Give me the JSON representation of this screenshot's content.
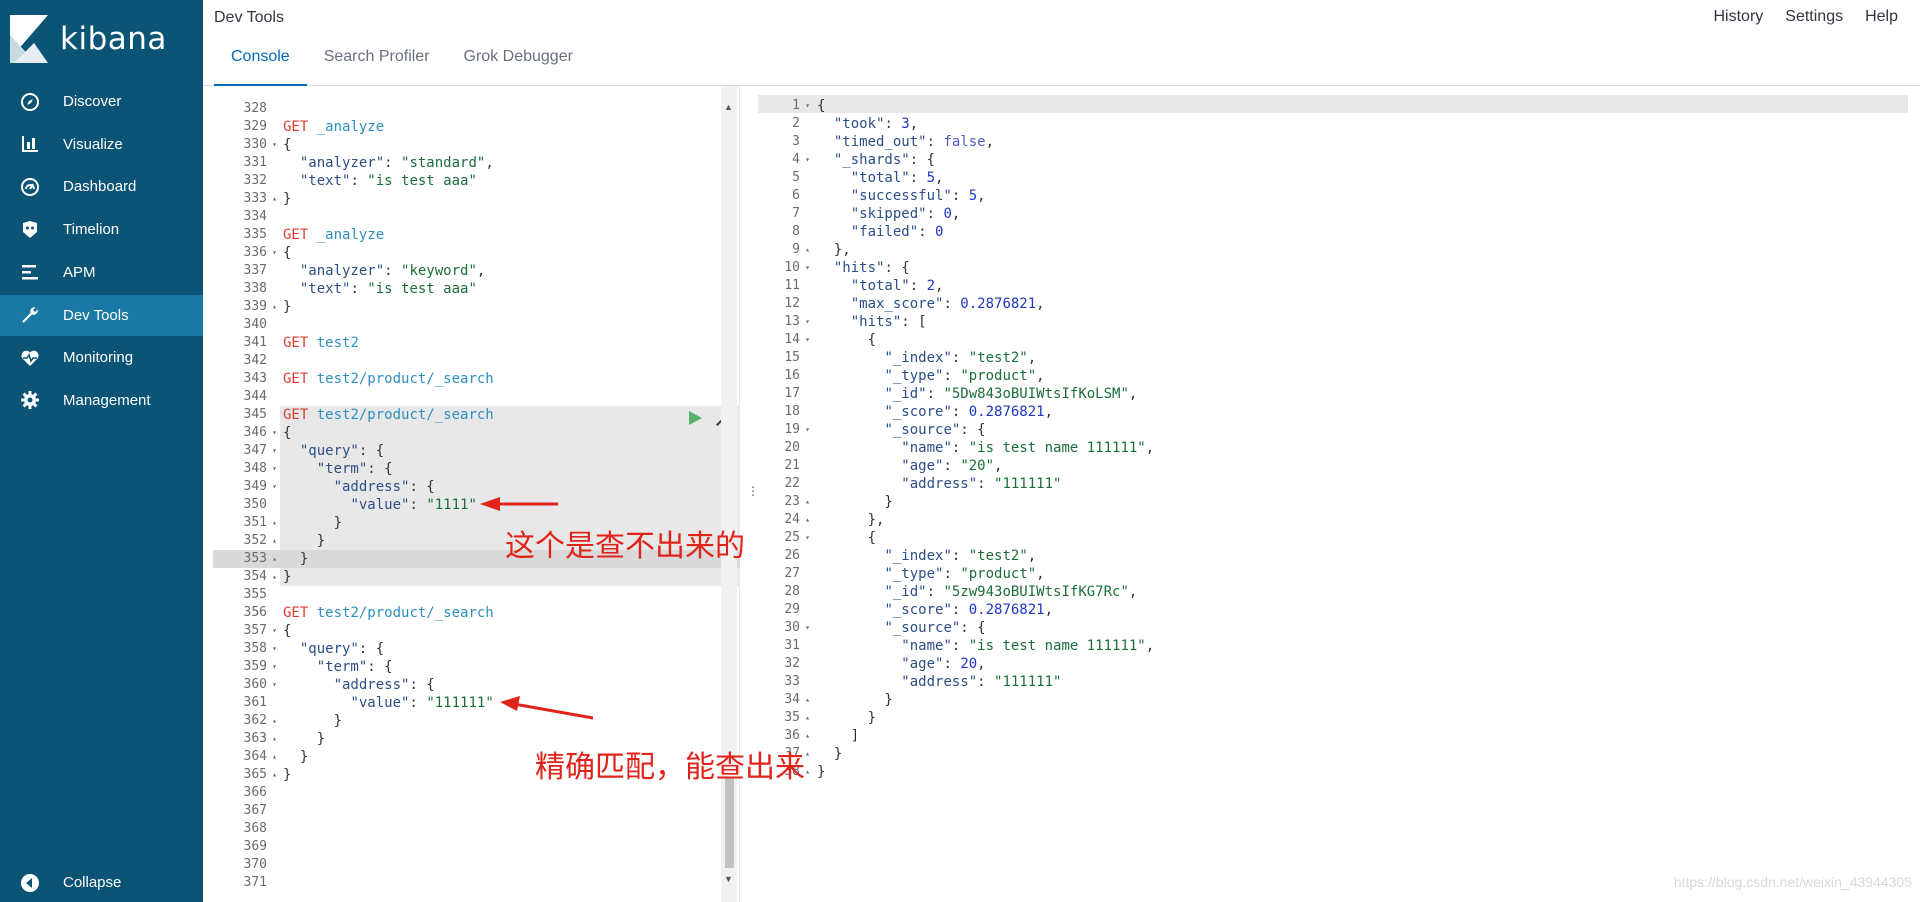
{
  "app": {
    "name": "kibana",
    "title": "Dev Tools"
  },
  "sidebar": {
    "items": [
      {
        "label": "Discover",
        "icon": "compass-icon"
      },
      {
        "label": "Visualize",
        "icon": "bar-chart-icon"
      },
      {
        "label": "Dashboard",
        "icon": "dashboard-icon"
      },
      {
        "label": "Timelion",
        "icon": "timelion-icon"
      },
      {
        "label": "APM",
        "icon": "apm-icon"
      },
      {
        "label": "Dev Tools",
        "icon": "wrench-icon",
        "active": true
      },
      {
        "label": "Monitoring",
        "icon": "heartbeat-icon"
      },
      {
        "label": "Management",
        "icon": "gear-icon"
      }
    ],
    "collapse": "Collapse"
  },
  "topnav": {
    "history": "History",
    "settings": "Settings",
    "help": "Help"
  },
  "tabs": [
    {
      "label": "Console",
      "active": true
    },
    {
      "label": "Search Profiler"
    },
    {
      "label": "Grok Debugger"
    }
  ],
  "colors": {
    "sidebar": "#0c5475",
    "sidebar_active": "#1a78a5",
    "accent": "#006bb4",
    "method": "#dd3b2e",
    "annotation": "#e0241a"
  },
  "request_lines": [
    {
      "n": "328",
      "f": "",
      "t": []
    },
    {
      "n": "329",
      "f": "",
      "t": [
        [
          "method",
          "GET"
        ],
        [
          "punc",
          " "
        ],
        [
          "path",
          "_analyze"
        ]
      ]
    },
    {
      "n": "330",
      "f": "▾",
      "t": [
        [
          "punc",
          "{"
        ]
      ]
    },
    {
      "n": "331",
      "f": "",
      "t": [
        [
          "punc",
          "  "
        ],
        [
          "key",
          "\"analyzer\""
        ],
        [
          "punc",
          ": "
        ],
        [
          "str",
          "\"standard\""
        ],
        [
          "punc",
          ","
        ]
      ]
    },
    {
      "n": "332",
      "f": "",
      "t": [
        [
          "punc",
          "  "
        ],
        [
          "key",
          "\"text\""
        ],
        [
          "punc",
          ": "
        ],
        [
          "str",
          "\"is test aaa\""
        ]
      ]
    },
    {
      "n": "333",
      "f": "▴",
      "t": [
        [
          "punc",
          "}"
        ]
      ]
    },
    {
      "n": "334",
      "f": "",
      "t": []
    },
    {
      "n": "335",
      "f": "",
      "t": [
        [
          "method",
          "GET"
        ],
        [
          "punc",
          " "
        ],
        [
          "path",
          "_analyze"
        ]
      ]
    },
    {
      "n": "336",
      "f": "▾",
      "t": [
        [
          "punc",
          "{"
        ]
      ]
    },
    {
      "n": "337",
      "f": "",
      "t": [
        [
          "punc",
          "  "
        ],
        [
          "key",
          "\"analyzer\""
        ],
        [
          "punc",
          ": "
        ],
        [
          "str",
          "\"keyword\""
        ],
        [
          "punc",
          ","
        ]
      ]
    },
    {
      "n": "338",
      "f": "",
      "t": [
        [
          "punc",
          "  "
        ],
        [
          "key",
          "\"text\""
        ],
        [
          "punc",
          ": "
        ],
        [
          "str",
          "\"is test aaa\""
        ]
      ]
    },
    {
      "n": "339",
      "f": "▴",
      "t": [
        [
          "punc",
          "}"
        ]
      ]
    },
    {
      "n": "340",
      "f": "",
      "t": []
    },
    {
      "n": "341",
      "f": "",
      "t": [
        [
          "method",
          "GET"
        ],
        [
          "punc",
          " "
        ],
        [
          "path",
          "test2"
        ]
      ]
    },
    {
      "n": "342",
      "f": "",
      "t": []
    },
    {
      "n": "343",
      "f": "",
      "t": [
        [
          "method",
          "GET"
        ],
        [
          "punc",
          " "
        ],
        [
          "path",
          "test2/product/_search"
        ]
      ]
    },
    {
      "n": "344",
      "f": "",
      "t": []
    },
    {
      "n": "345",
      "f": "",
      "t": [
        [
          "method",
          "GET"
        ],
        [
          "punc",
          " "
        ],
        [
          "path",
          "test2/product/_search"
        ]
      ]
    },
    {
      "n": "346",
      "f": "▾",
      "t": [
        [
          "punc",
          "{"
        ]
      ]
    },
    {
      "n": "347",
      "f": "▾",
      "t": [
        [
          "punc",
          "  "
        ],
        [
          "key",
          "\"query\""
        ],
        [
          "punc",
          ": {"
        ]
      ]
    },
    {
      "n": "348",
      "f": "▾",
      "t": [
        [
          "punc",
          "    "
        ],
        [
          "key",
          "\"term\""
        ],
        [
          "punc",
          ": {"
        ]
      ]
    },
    {
      "n": "349",
      "f": "▾",
      "t": [
        [
          "punc",
          "      "
        ],
        [
          "key",
          "\"address\""
        ],
        [
          "punc",
          ": {"
        ]
      ]
    },
    {
      "n": "350",
      "f": "",
      "t": [
        [
          "punc",
          "        "
        ],
        [
          "key",
          "\"value\""
        ],
        [
          "punc",
          ": "
        ],
        [
          "str",
          "\"1111\""
        ]
      ]
    },
    {
      "n": "351",
      "f": "▴",
      "t": [
        [
          "punc",
          "      }"
        ]
      ]
    },
    {
      "n": "352",
      "f": "▴",
      "t": [
        [
          "punc",
          "    }"
        ]
      ]
    },
    {
      "n": "353",
      "f": "▴",
      "t": [
        [
          "punc",
          "  }"
        ]
      ]
    },
    {
      "n": "354",
      "f": "▴",
      "t": [
        [
          "punc",
          "}"
        ]
      ]
    },
    {
      "n": "355",
      "f": "",
      "t": []
    },
    {
      "n": "356",
      "f": "",
      "t": [
        [
          "method",
          "GET"
        ],
        [
          "punc",
          " "
        ],
        [
          "path",
          "test2/product/_search"
        ]
      ]
    },
    {
      "n": "357",
      "f": "▾",
      "t": [
        [
          "punc",
          "{"
        ]
      ]
    },
    {
      "n": "358",
      "f": "▾",
      "t": [
        [
          "punc",
          "  "
        ],
        [
          "key",
          "\"query\""
        ],
        [
          "punc",
          ": {"
        ]
      ]
    },
    {
      "n": "359",
      "f": "▾",
      "t": [
        [
          "punc",
          "    "
        ],
        [
          "key",
          "\"term\""
        ],
        [
          "punc",
          ": {"
        ]
      ]
    },
    {
      "n": "360",
      "f": "▾",
      "t": [
        [
          "punc",
          "      "
        ],
        [
          "key",
          "\"address\""
        ],
        [
          "punc",
          ": {"
        ]
      ]
    },
    {
      "n": "361",
      "f": "",
      "t": [
        [
          "punc",
          "        "
        ],
        [
          "key",
          "\"value\""
        ],
        [
          "punc",
          ": "
        ],
        [
          "str",
          "\"111111\""
        ]
      ]
    },
    {
      "n": "362",
      "f": "▴",
      "t": [
        [
          "punc",
          "      }"
        ]
      ]
    },
    {
      "n": "363",
      "f": "▴",
      "t": [
        [
          "punc",
          "    }"
        ]
      ]
    },
    {
      "n": "364",
      "f": "▴",
      "t": [
        [
          "punc",
          "  }"
        ]
      ]
    },
    {
      "n": "365",
      "f": "▴",
      "t": [
        [
          "punc",
          "}"
        ]
      ]
    },
    {
      "n": "366",
      "f": "",
      "t": []
    },
    {
      "n": "367",
      "f": "",
      "t": []
    },
    {
      "n": "368",
      "f": "",
      "t": []
    },
    {
      "n": "369",
      "f": "",
      "t": []
    },
    {
      "n": "370",
      "f": "",
      "t": []
    },
    {
      "n": "371",
      "f": "",
      "t": []
    }
  ],
  "response_lines": [
    {
      "n": "1",
      "f": "▾",
      "t": [
        [
          "punc",
          "{"
        ]
      ]
    },
    {
      "n": "2",
      "f": "",
      "t": [
        [
          "punc",
          "  "
        ],
        [
          "key",
          "\"took\""
        ],
        [
          "punc",
          ": "
        ],
        [
          "num",
          "3"
        ],
        [
          "punc",
          ","
        ]
      ]
    },
    {
      "n": "3",
      "f": "",
      "t": [
        [
          "punc",
          "  "
        ],
        [
          "key",
          "\"timed_out\""
        ],
        [
          "punc",
          ": "
        ],
        [
          "bool",
          "false"
        ],
        [
          "punc",
          ","
        ]
      ]
    },
    {
      "n": "4",
      "f": "▾",
      "t": [
        [
          "punc",
          "  "
        ],
        [
          "key",
          "\"_shards\""
        ],
        [
          "punc",
          ": {"
        ]
      ]
    },
    {
      "n": "5",
      "f": "",
      "t": [
        [
          "punc",
          "    "
        ],
        [
          "key",
          "\"total\""
        ],
        [
          "punc",
          ": "
        ],
        [
          "num",
          "5"
        ],
        [
          "punc",
          ","
        ]
      ]
    },
    {
      "n": "6",
      "f": "",
      "t": [
        [
          "punc",
          "    "
        ],
        [
          "key",
          "\"successful\""
        ],
        [
          "punc",
          ": "
        ],
        [
          "num",
          "5"
        ],
        [
          "punc",
          ","
        ]
      ]
    },
    {
      "n": "7",
      "f": "",
      "t": [
        [
          "punc",
          "    "
        ],
        [
          "key",
          "\"skipped\""
        ],
        [
          "punc",
          ": "
        ],
        [
          "num",
          "0"
        ],
        [
          "punc",
          ","
        ]
      ]
    },
    {
      "n": "8",
      "f": "",
      "t": [
        [
          "punc",
          "    "
        ],
        [
          "key",
          "\"failed\""
        ],
        [
          "punc",
          ": "
        ],
        [
          "num",
          "0"
        ]
      ]
    },
    {
      "n": "9",
      "f": "▴",
      "t": [
        [
          "punc",
          "  },"
        ]
      ]
    },
    {
      "n": "10",
      "f": "▾",
      "t": [
        [
          "punc",
          "  "
        ],
        [
          "key",
          "\"hits\""
        ],
        [
          "punc",
          ": {"
        ]
      ]
    },
    {
      "n": "11",
      "f": "",
      "t": [
        [
          "punc",
          "    "
        ],
        [
          "key",
          "\"total\""
        ],
        [
          "punc",
          ": "
        ],
        [
          "num",
          "2"
        ],
        [
          "punc",
          ","
        ]
      ]
    },
    {
      "n": "12",
      "f": "",
      "t": [
        [
          "punc",
          "    "
        ],
        [
          "key",
          "\"max_score\""
        ],
        [
          "punc",
          ": "
        ],
        [
          "num",
          "0.2876821"
        ],
        [
          "punc",
          ","
        ]
      ]
    },
    {
      "n": "13",
      "f": "▾",
      "t": [
        [
          "punc",
          "    "
        ],
        [
          "key",
          "\"hits\""
        ],
        [
          "punc",
          ": ["
        ]
      ]
    },
    {
      "n": "14",
      "f": "▾",
      "t": [
        [
          "punc",
          "      {"
        ]
      ]
    },
    {
      "n": "15",
      "f": "",
      "t": [
        [
          "punc",
          "        "
        ],
        [
          "key",
          "\"_index\""
        ],
        [
          "punc",
          ": "
        ],
        [
          "str",
          "\"test2\""
        ],
        [
          "punc",
          ","
        ]
      ]
    },
    {
      "n": "16",
      "f": "",
      "t": [
        [
          "punc",
          "        "
        ],
        [
          "key",
          "\"_type\""
        ],
        [
          "punc",
          ": "
        ],
        [
          "str",
          "\"product\""
        ],
        [
          "punc",
          ","
        ]
      ]
    },
    {
      "n": "17",
      "f": "",
      "t": [
        [
          "punc",
          "        "
        ],
        [
          "key",
          "\"_id\""
        ],
        [
          "punc",
          ": "
        ],
        [
          "str",
          "\"5Dw843oBUIWtsIfKoLSM\""
        ],
        [
          "punc",
          ","
        ]
      ]
    },
    {
      "n": "18",
      "f": "",
      "t": [
        [
          "punc",
          "        "
        ],
        [
          "key",
          "\"_score\""
        ],
        [
          "punc",
          ": "
        ],
        [
          "num",
          "0.2876821"
        ],
        [
          "punc",
          ","
        ]
      ]
    },
    {
      "n": "19",
      "f": "▾",
      "t": [
        [
          "punc",
          "        "
        ],
        [
          "key",
          "\"_source\""
        ],
        [
          "punc",
          ": {"
        ]
      ]
    },
    {
      "n": "20",
      "f": "",
      "t": [
        [
          "punc",
          "          "
        ],
        [
          "key",
          "\"name\""
        ],
        [
          "punc",
          ": "
        ],
        [
          "str",
          "\"is test name 111111\""
        ],
        [
          "punc",
          ","
        ]
      ]
    },
    {
      "n": "21",
      "f": "",
      "t": [
        [
          "punc",
          "          "
        ],
        [
          "key",
          "\"age\""
        ],
        [
          "punc",
          ": "
        ],
        [
          "str",
          "\"20\""
        ],
        [
          "punc",
          ","
        ]
      ]
    },
    {
      "n": "22",
      "f": "",
      "t": [
        [
          "punc",
          "          "
        ],
        [
          "key",
          "\"address\""
        ],
        [
          "punc",
          ": "
        ],
        [
          "str",
          "\"111111\""
        ]
      ]
    },
    {
      "n": "23",
      "f": "▴",
      "t": [
        [
          "punc",
          "        }"
        ]
      ]
    },
    {
      "n": "24",
      "f": "▴",
      "t": [
        [
          "punc",
          "      },"
        ]
      ]
    },
    {
      "n": "25",
      "f": "▾",
      "t": [
        [
          "punc",
          "      {"
        ]
      ]
    },
    {
      "n": "26",
      "f": "",
      "t": [
        [
          "punc",
          "        "
        ],
        [
          "key",
          "\"_index\""
        ],
        [
          "punc",
          ": "
        ],
        [
          "str",
          "\"test2\""
        ],
        [
          "punc",
          ","
        ]
      ]
    },
    {
      "n": "27",
      "f": "",
      "t": [
        [
          "punc",
          "        "
        ],
        [
          "key",
          "\"_type\""
        ],
        [
          "punc",
          ": "
        ],
        [
          "str",
          "\"product\""
        ],
        [
          "punc",
          ","
        ]
      ]
    },
    {
      "n": "28",
      "f": "",
      "t": [
        [
          "punc",
          "        "
        ],
        [
          "key",
          "\"_id\""
        ],
        [
          "punc",
          ": "
        ],
        [
          "str",
          "\"5zw943oBUIWtsIfKG7Rc\""
        ],
        [
          "punc",
          ","
        ]
      ]
    },
    {
      "n": "29",
      "f": "",
      "t": [
        [
          "punc",
          "        "
        ],
        [
          "key",
          "\"_score\""
        ],
        [
          "punc",
          ": "
        ],
        [
          "num",
          "0.2876821"
        ],
        [
          "punc",
          ","
        ]
      ]
    },
    {
      "n": "30",
      "f": "▾",
      "t": [
        [
          "punc",
          "        "
        ],
        [
          "key",
          "\"_source\""
        ],
        [
          "punc",
          ": {"
        ]
      ]
    },
    {
      "n": "31",
      "f": "",
      "t": [
        [
          "punc",
          "          "
        ],
        [
          "key",
          "\"name\""
        ],
        [
          "punc",
          ": "
        ],
        [
          "str",
          "\"is test name 111111\""
        ],
        [
          "punc",
          ","
        ]
      ]
    },
    {
      "n": "32",
      "f": "",
      "t": [
        [
          "punc",
          "          "
        ],
        [
          "key",
          "\"age\""
        ],
        [
          "punc",
          ": "
        ],
        [
          "num",
          "20"
        ],
        [
          "punc",
          ","
        ]
      ]
    },
    {
      "n": "33",
      "f": "",
      "t": [
        [
          "punc",
          "          "
        ],
        [
          "key",
          "\"address\""
        ],
        [
          "punc",
          ": "
        ],
        [
          "str",
          "\"111111\""
        ]
      ]
    },
    {
      "n": "34",
      "f": "▴",
      "t": [
        [
          "punc",
          "        }"
        ]
      ]
    },
    {
      "n": "35",
      "f": "▴",
      "t": [
        [
          "punc",
          "      }"
        ]
      ]
    },
    {
      "n": "36",
      "f": "▴",
      "t": [
        [
          "punc",
          "    ]"
        ]
      ]
    },
    {
      "n": "37",
      "f": "▴",
      "t": [
        [
          "punc",
          "  }"
        ]
      ]
    },
    {
      "n": "38",
      "f": "▴",
      "t": [
        [
          "punc",
          "}"
        ]
      ]
    }
  ],
  "annotations": {
    "not_found": "这个是查不出来的",
    "exact_match": "精确匹配，能查出来"
  },
  "watermark": "https://blog.csdn.net/weixin_43944305"
}
